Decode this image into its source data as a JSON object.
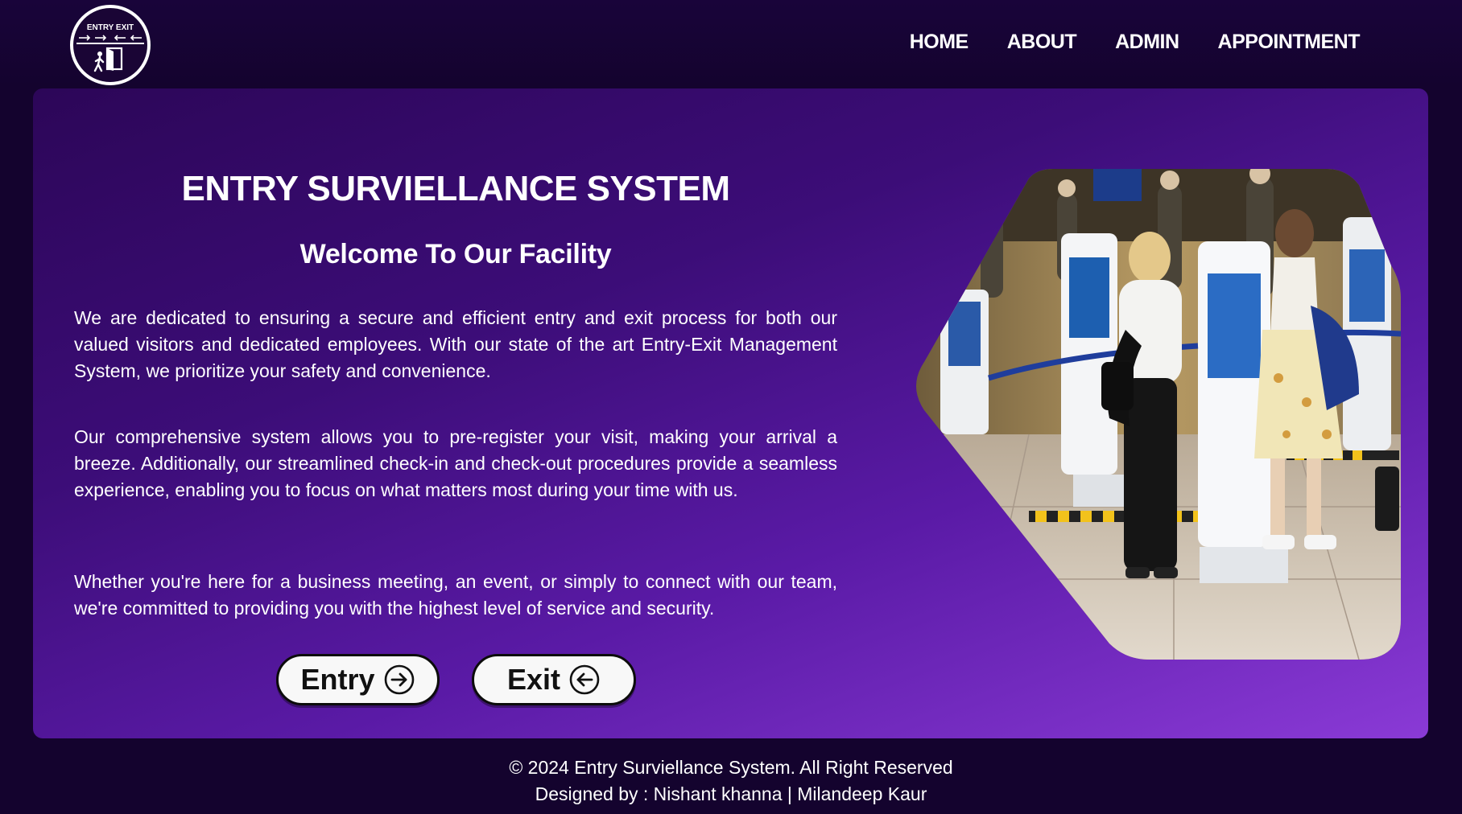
{
  "header": {
    "logo": {
      "text": "ENTRY EXIT",
      "icon": "entry-exit-person-door-logo"
    },
    "nav": [
      {
        "label": "HOME"
      },
      {
        "label": "ABOUT"
      },
      {
        "label": "ADMIN"
      },
      {
        "label": "APPOINTMENT"
      }
    ]
  },
  "hero": {
    "title": "ENTRY SURVIELLANCE SYSTEM",
    "subtitle": "Welcome To Our Facility",
    "paragraphs": [
      "We are dedicated to ensuring a secure and efficient entry and exit process for both our valued visitors and dedicated employees. With our state of the art Entry-Exit Management System, we prioritize your safety and convenience.",
      "Our comprehensive system allows you to pre-register your visit, making your arrival a breeze. Additionally, our streamlined check-in and check-out procedures provide a seamless experience, enabling you to focus on what matters most during your time with us.",
      "Whether you're here for a business meeting, an event, or simply to connect with our team, we're committed to providing you with the highest level of service and security."
    ],
    "buttons": {
      "entry": {
        "label": "Entry",
        "icon": "arrow-right-circle-icon"
      },
      "exit": {
        "label": "Exit",
        "icon": "arrow-left-circle-icon"
      }
    },
    "image": {
      "subject": "people using self-service check-in kiosks"
    }
  },
  "footer": {
    "copyright": "© 2024 Entry Surviellance System. All Right Reserved",
    "credits": "Designed by : Nishant khanna | Milandeep Kaur"
  },
  "colors": {
    "page_background": "#14032e",
    "hero_gradient_start": "#2c0658",
    "hero_gradient_end": "#8a3ad6",
    "text": "#ffffff",
    "button_background": "#f8f8f8",
    "button_text": "#111111"
  }
}
